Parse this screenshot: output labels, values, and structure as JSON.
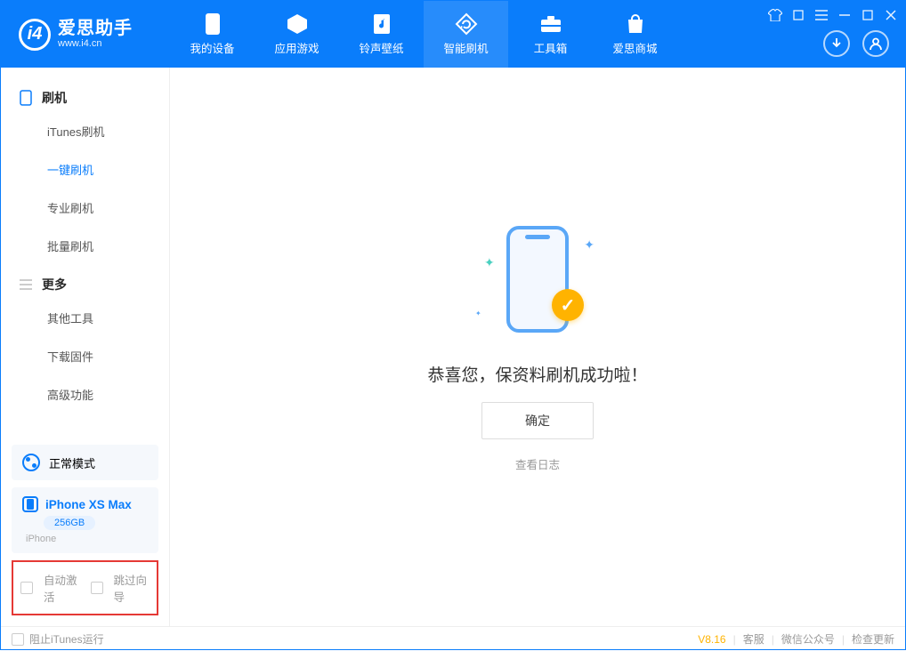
{
  "app": {
    "title": "爱思助手",
    "subtitle": "www.i4.cn"
  },
  "nav": {
    "tabs": [
      {
        "label": "我的设备",
        "icon": "phone-icon"
      },
      {
        "label": "应用游戏",
        "icon": "cube-icon"
      },
      {
        "label": "铃声壁纸",
        "icon": "music-icon"
      },
      {
        "label": "智能刷机",
        "icon": "refresh-icon",
        "active": true
      },
      {
        "label": "工具箱",
        "icon": "toolbox-icon"
      },
      {
        "label": "爱思商城",
        "icon": "bag-icon"
      }
    ]
  },
  "sidebar": {
    "sections": [
      {
        "title": "刷机",
        "icon": "phone-outline-icon",
        "items": [
          {
            "label": "iTunes刷机"
          },
          {
            "label": "一键刷机",
            "active": true
          },
          {
            "label": "专业刷机"
          },
          {
            "label": "批量刷机"
          }
        ]
      },
      {
        "title": "更多",
        "icon": "menu-icon",
        "items": [
          {
            "label": "其他工具"
          },
          {
            "label": "下载固件"
          },
          {
            "label": "高级功能"
          }
        ]
      }
    ],
    "mode": {
      "label": "正常模式"
    },
    "device": {
      "name": "iPhone XS Max",
      "capacity": "256GB",
      "type": "iPhone"
    },
    "options": {
      "auto_activate": "自动激活",
      "skip_guide": "跳过向导"
    }
  },
  "main": {
    "success_title": "恭喜您，保资料刷机成功啦！",
    "ok_label": "确定",
    "log_link": "查看日志"
  },
  "footer": {
    "block_itunes": "阻止iTunes运行",
    "version": "V8.16",
    "links": {
      "service": "客服",
      "wechat": "微信公众号",
      "update": "检查更新"
    }
  }
}
